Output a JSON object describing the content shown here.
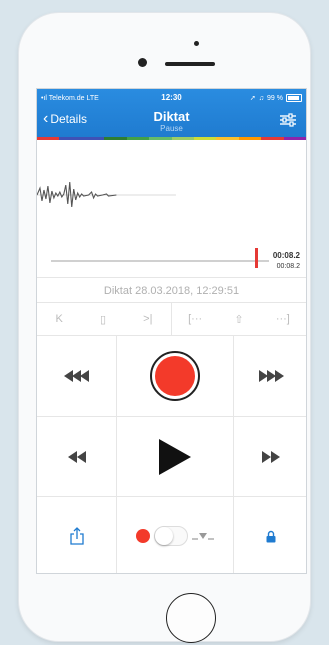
{
  "status": {
    "carrier": "Telekom.de",
    "network": "LTE",
    "time": "12:30",
    "battery": "99 %"
  },
  "nav": {
    "back_label": "Details",
    "title": "Diktat",
    "subtitle": "Pause"
  },
  "colors": {
    "nav": "#1f7bd0",
    "record": "#f33a2a",
    "playhead": "#e53935",
    "colorbar": [
      "#e53935",
      "#3f51b5",
      "#3f51b5",
      "#2e7d32",
      "#43a047",
      "#66bb6a",
      "#9ccc65",
      "#cddc39",
      "#fbc02d",
      "#ff9800",
      "#e53935",
      "#8e24aa"
    ]
  },
  "playback": {
    "position": "00:08.2",
    "duration": "00:08.2",
    "progress": 1.0
  },
  "recording_name": "Diktat 28.03.2018, 12:29:51",
  "tools": {
    "left": [
      "jump-start-icon",
      "bookmark-icon",
      "jump-end-icon"
    ],
    "right": [
      "mark-in-icon",
      "upload-icon",
      "mark-out-icon"
    ]
  },
  "controls": {
    "rewind_fast": "fast-rewind-icon",
    "record": "record-button",
    "forward_fast": "fast-forward-icon",
    "rewind": "rewind-icon",
    "play": "play-icon",
    "forward": "forward-icon",
    "share": "share-icon",
    "toggle": "voice-activation-toggle",
    "lock": "lock-icon"
  }
}
